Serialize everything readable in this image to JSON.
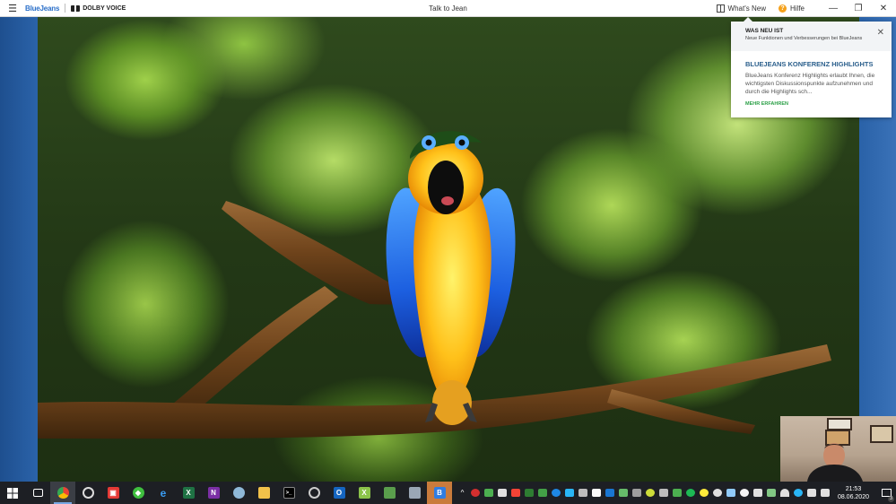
{
  "window": {
    "brand": "BlueJeans",
    "dolby": "DOLBY VOICE",
    "title": "Talk to Jean",
    "whats_new": "What's New",
    "help": "Hilfe"
  },
  "whats_new_panel": {
    "title": "WAS NEU IST",
    "subtitle": "Neue Funktionen und Verbesserungen bei BlueJeans",
    "heading": "BLUEJEANS KONFERENZ HIGHLIGHTS",
    "text": "BlueJeans Konferenz Highlights erlaubt Ihnen, die wichtigsten Diskussionspunkte aufzunehmen und durch die Highlights sch...",
    "link": "MEHR ERFAHREN"
  },
  "taskbar": {
    "time": "21:53",
    "date": "08.06.2020",
    "notifications": "3"
  },
  "colors": {
    "brand_blue": "#2a6fc9",
    "highlight_heading": "#2b5f8c",
    "link_green": "#2a9f46",
    "help_orange": "#f5a11b",
    "taskbar": "#1d1f24"
  }
}
